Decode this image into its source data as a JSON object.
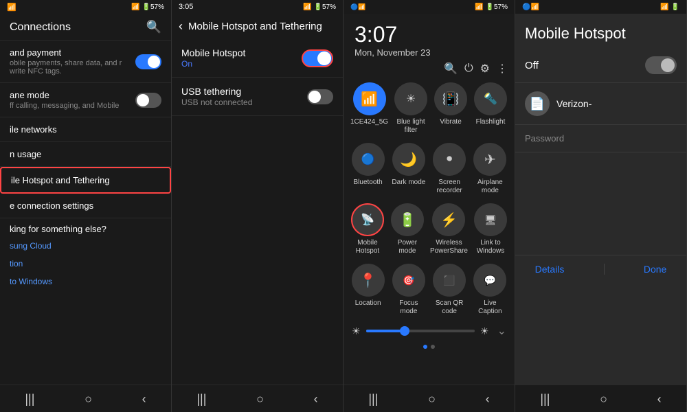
{
  "panel1": {
    "title": "Connections",
    "items": [
      {
        "label": "and payment",
        "sublabel": "obile payments, share data, and\nr write NFC tags.",
        "hasToggle": true,
        "toggleOn": true
      },
      {
        "label": "ane mode",
        "sublabel": "ff calling, messaging, and Mobile",
        "hasToggle": true,
        "toggleOn": false
      },
      {
        "sectionLabel": ""
      },
      {
        "label": "ile networks",
        "hasToggle": false
      },
      {
        "label": "n usage",
        "hasToggle": false
      },
      {
        "label": "ile Hotspot and Tethering",
        "hasToggle": false,
        "highlighted": true
      },
      {
        "label": "e connection settings",
        "hasToggle": false
      }
    ],
    "looking_label": "king for something else?",
    "links": [
      "sung Cloud",
      "tion",
      "to Windows"
    ],
    "nav": [
      "|||",
      "○",
      "‹"
    ]
  },
  "panel2": {
    "back_icon": "‹",
    "title": "Mobile Hotspot and Tethering",
    "items": [
      {
        "label": "Mobile Hotspot",
        "sublabel": "On",
        "sublabelColor": "blue",
        "toggleOn": true,
        "highlighted": true
      },
      {
        "label": "USB tethering",
        "sublabel": "USB not connected",
        "sublabelColor": "gray",
        "toggleOn": false
      }
    ],
    "nav": [
      "|||",
      "○",
      "‹"
    ]
  },
  "panel3": {
    "clock": "3:07",
    "date": "Mon, November 23",
    "status_icons": [
      "🔵",
      "📶",
      "🔋57%"
    ],
    "qs_icons_row1": [
      {
        "label": "1CE424_5G",
        "icon": "📶",
        "active": true
      },
      {
        "label": "Blue light\nfilter",
        "icon": "💡",
        "active": false
      },
      {
        "label": "Vibrate",
        "icon": "📳",
        "active": false
      },
      {
        "label": "Flashlight",
        "icon": "🔦",
        "active": false
      }
    ],
    "qs_icons_row2": [
      {
        "label": "Bluetooth",
        "icon": "🔵",
        "active": false
      },
      {
        "label": "Dark mode",
        "icon": "🌙",
        "active": false
      },
      {
        "label": "Screen\nrecorder",
        "icon": "⏺",
        "active": false
      },
      {
        "label": "Airplane\nmode",
        "icon": "✈",
        "active": false
      }
    ],
    "qs_icons_row3": [
      {
        "label": "Mobile\nHotspot",
        "icon": "📡",
        "active": false,
        "highlighted": true
      },
      {
        "label": "Power\nmode",
        "icon": "🔋",
        "active": false
      },
      {
        "label": "Wireless\nPowerShare",
        "icon": "⚡",
        "active": false
      },
      {
        "label": "Link to\nWindows",
        "icon": "🖥",
        "active": false
      }
    ],
    "qs_icons_row4": [
      {
        "label": "Location",
        "icon": "📍",
        "active": false
      },
      {
        "label": "Focus mode",
        "icon": "🎯",
        "active": false
      },
      {
        "label": "Scan QR\ncode",
        "icon": "⬛",
        "active": false
      },
      {
        "label": "Live Caption",
        "icon": "💬",
        "active": false
      }
    ],
    "brightness": 35,
    "nav": [
      "|||",
      "○",
      "‹"
    ]
  },
  "panel4": {
    "title": "Mobile Hotspot",
    "off_label": "Off",
    "network_icon": "📄",
    "network_name": "Verizon-",
    "password_label": "Password",
    "footer_details": "Details",
    "footer_done": "Done",
    "nav": [
      "|||",
      "○",
      "‹"
    ]
  }
}
